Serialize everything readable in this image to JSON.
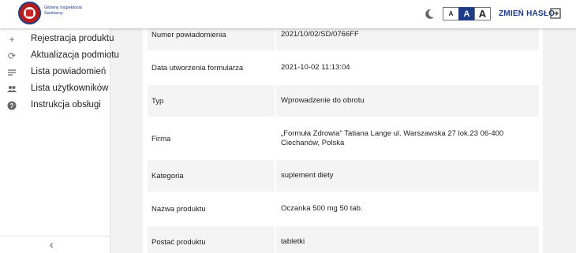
{
  "header": {
    "brand_line1": "Główny Inspektorat",
    "brand_line2": "Sanitarny",
    "font_small": "A",
    "font_medium": "A",
    "font_large": "A",
    "change_password": "ZMIEŃ HASŁO",
    "icons": [
      "moon-icon",
      "logout-icon"
    ]
  },
  "sidebar": {
    "items": [
      {
        "icon": "plus-icon",
        "label": "Rejestracja produktu"
      },
      {
        "icon": "refresh-icon",
        "label": "Aktualizacja podmiotu"
      },
      {
        "icon": "list-icon",
        "label": "Lista powiadomień"
      },
      {
        "icon": "users-icon",
        "label": "Lista użytkowników"
      },
      {
        "icon": "help-icon",
        "label": "Instrukcja obsługi"
      }
    ],
    "collapse_icon": "chevron-left-icon"
  },
  "details": [
    {
      "label": "Numer powiadomienia",
      "value": "2021/10/02/SD/0766FF"
    },
    {
      "label": "Data utworzenia formularza",
      "value": "2021-10-02 11:13:04"
    },
    {
      "label": "Typ",
      "value": "Wprowadzenie do obrotu"
    },
    {
      "label": "Firma",
      "value": "„Formuła Zdrowia\" Tatiana Lange ul. Warszawska 27 lok.23 06-400 Ciechanów, Polska"
    },
    {
      "label": "Kategoria",
      "value": "suplement diety"
    },
    {
      "label": "Nazwa produktu",
      "value": "Oczanka 500 mg 50 tab."
    },
    {
      "label": "Postać produktu",
      "value": "tabletki"
    }
  ],
  "colors": {
    "brand": "#1f3c88",
    "logo_red": "#b71c1c",
    "row_shade": "#f4f4f4"
  }
}
